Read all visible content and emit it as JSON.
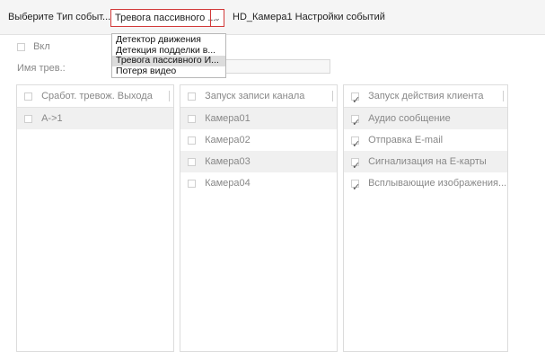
{
  "header": {
    "event_type_label": "Выберите Тип событ...",
    "selected_event": "Тревога пассивного ...",
    "arrow_glyph": "⌄",
    "settings_title": "HD_Камера1 Настройки событий"
  },
  "dropdown": {
    "options": [
      "Детектор движения",
      "Детекция подделки в...",
      "Тревога пассивного И...",
      "Потеря видео"
    ],
    "selected_index": 2
  },
  "form": {
    "enable_label": "Вкл",
    "alarm_name_label": "Имя трев.:",
    "alarm_name_value": ""
  },
  "panels": {
    "alarm_outputs": {
      "header": "Сработ. тревож. Выхода",
      "items": [
        {
          "label": "A->1",
          "checked": false
        }
      ]
    },
    "channel_recording": {
      "header": "Запуск записи канала",
      "items": [
        {
          "label": "Камера01",
          "checked": false
        },
        {
          "label": "Камера02",
          "checked": false
        },
        {
          "label": "Камера03",
          "checked": false
        },
        {
          "label": "Камера04",
          "checked": false
        }
      ]
    },
    "client_actions": {
      "header": "Запуск действия клиента",
      "header_checked": true,
      "items": [
        {
          "label": "Аудио сообщение",
          "checked": true
        },
        {
          "label": "Отправка E-mail",
          "checked": true
        },
        {
          "label": "Сигнализация на Е-карты",
          "checked": true
        },
        {
          "label": "Всплывающие изображения...",
          "checked": true
        }
      ]
    }
  }
}
